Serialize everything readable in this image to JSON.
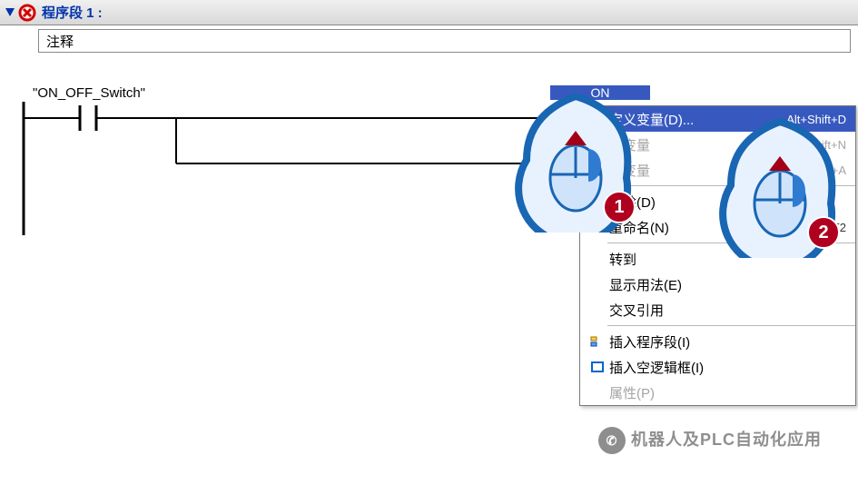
{
  "header": {
    "title": "程序段 1 :",
    "comment": "注释"
  },
  "ladder": {
    "switch_label": "\"ON_OFF_Switch\"",
    "coil_label": "ON"
  },
  "menu": {
    "items": [
      {
        "label": "定义变量(D)...",
        "shortcut": "Alt+Shift+D",
        "selected": true
      },
      {
        "label": "名变量",
        "shortcut": "Alt+Shift+N",
        "disabled": true
      },
      {
        "label": "接变量",
        "shortcut": "t+A",
        "disabled": true
      },
      {
        "sep": true
      },
      {
        "label": "删除(D)",
        "icon": "delete"
      },
      {
        "label": "重命名(N)",
        "shortcut": "F2"
      },
      {
        "sep": true
      },
      {
        "label": "转到"
      },
      {
        "label": "显示用法(E)"
      },
      {
        "label": "交叉引用"
      },
      {
        "sep": true
      },
      {
        "label": "插入程序段(I)",
        "icon": "insert-seg"
      },
      {
        "label": "插入空逻辑框(I)",
        "icon": "insert-block"
      },
      {
        "label": "属性(P)",
        "disabled": true
      }
    ]
  },
  "bubbles": [
    {
      "badge": "1"
    },
    {
      "badge": "2"
    }
  ],
  "signature": "机器人及PLC自动化应用"
}
